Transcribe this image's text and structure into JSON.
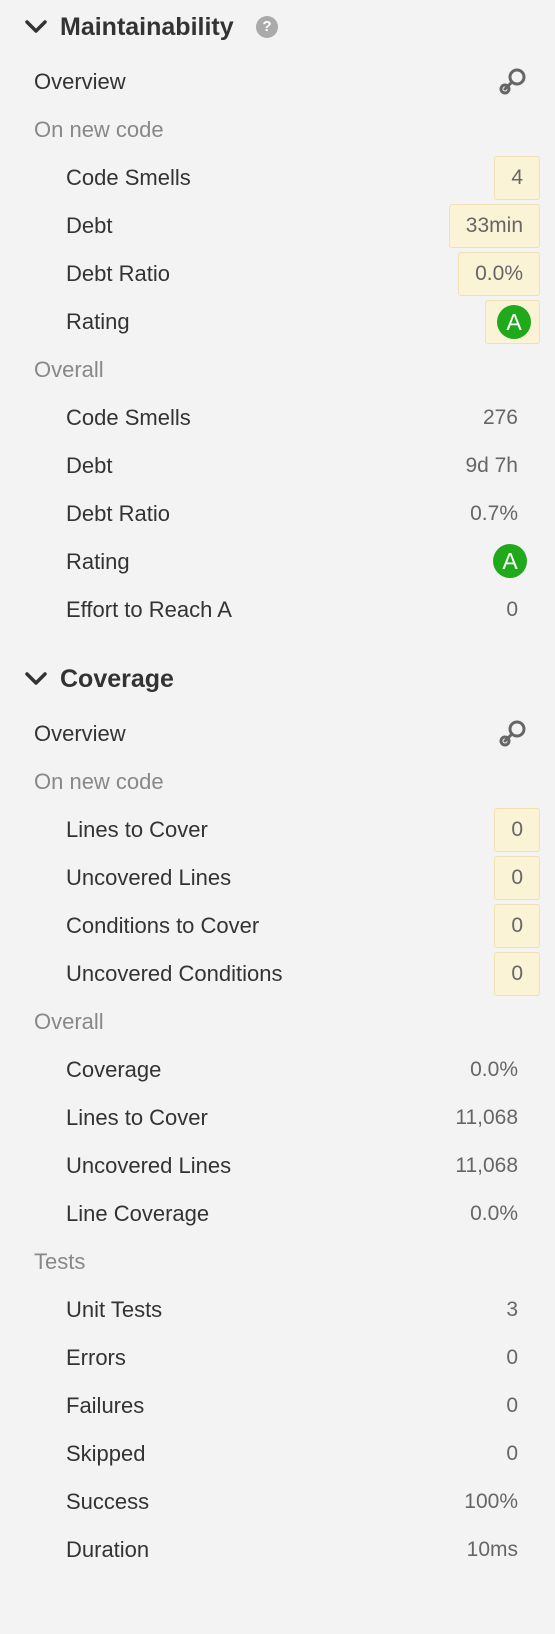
{
  "maintainability": {
    "title": "Maintainability",
    "help_icon": "?",
    "overview_label": "Overview",
    "new_code_label": "On new code",
    "new_code": {
      "code_smells": {
        "label": "Code Smells",
        "value": "4"
      },
      "debt": {
        "label": "Debt",
        "value": "33min"
      },
      "debt_ratio": {
        "label": "Debt Ratio",
        "value": "0.0%"
      },
      "rating": {
        "label": "Rating",
        "value": "A"
      }
    },
    "overall_label": "Overall",
    "overall": {
      "code_smells": {
        "label": "Code Smells",
        "value": "276"
      },
      "debt": {
        "label": "Debt",
        "value": "9d 7h"
      },
      "debt_ratio": {
        "label": "Debt Ratio",
        "value": "0.7%"
      },
      "rating": {
        "label": "Rating",
        "value": "A"
      },
      "effort": {
        "label": "Effort to Reach A",
        "value": "0"
      }
    }
  },
  "coverage": {
    "title": "Coverage",
    "overview_label": "Overview",
    "new_code_label": "On new code",
    "new_code": {
      "lines_to_cover": {
        "label": "Lines to Cover",
        "value": "0"
      },
      "uncovered_lines": {
        "label": "Uncovered Lines",
        "value": "0"
      },
      "conditions_to_cover": {
        "label": "Conditions to Cover",
        "value": "0"
      },
      "uncovered_conditions": {
        "label": "Uncovered Conditions",
        "value": "0"
      }
    },
    "overall_label": "Overall",
    "overall": {
      "coverage": {
        "label": "Coverage",
        "value": "0.0%"
      },
      "lines_to_cover": {
        "label": "Lines to Cover",
        "value": "11,068"
      },
      "uncovered_lines": {
        "label": "Uncovered Lines",
        "value": "11,068"
      },
      "line_coverage": {
        "label": "Line Coverage",
        "value": "0.0%"
      }
    },
    "tests_label": "Tests",
    "tests": {
      "unit_tests": {
        "label": "Unit Tests",
        "value": "3"
      },
      "errors": {
        "label": "Errors",
        "value": "0"
      },
      "failures": {
        "label": "Failures",
        "value": "0"
      },
      "skipped": {
        "label": "Skipped",
        "value": "0"
      },
      "success": {
        "label": "Success",
        "value": "100%"
      },
      "duration": {
        "label": "Duration",
        "value": "10ms"
      }
    }
  },
  "icons": {
    "chevron": "chevron-down-icon",
    "overview": "search-icon",
    "help": "help-icon"
  },
  "colors": {
    "rating_a": "#21a91c",
    "highlight_bg": "#fbf3d5",
    "highlight_border": "#efe1b3",
    "background": "#f3f3f3"
  }
}
